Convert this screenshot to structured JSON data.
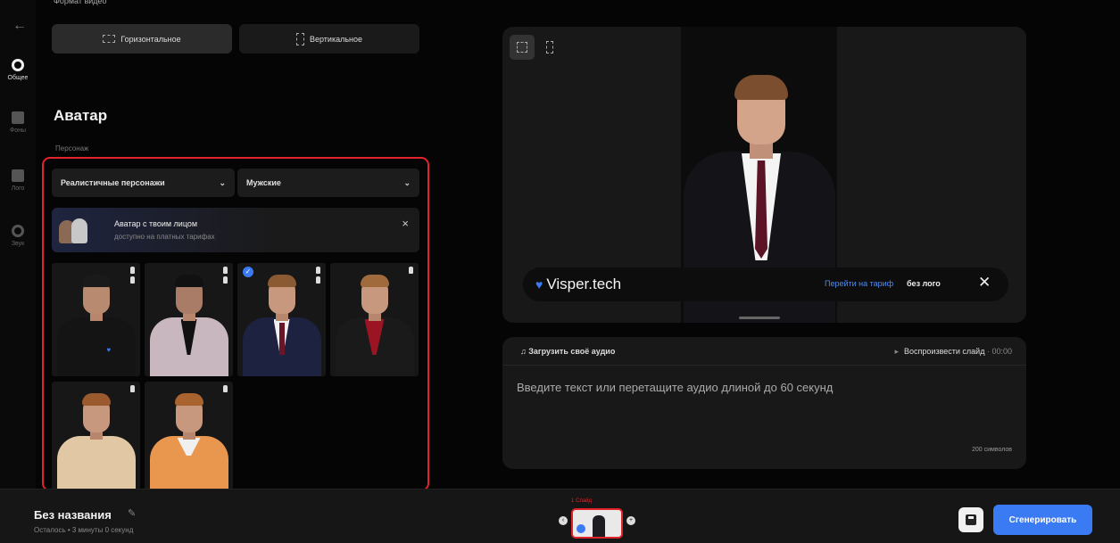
{
  "rail": {
    "items": [
      {
        "label": "Общее",
        "icon": "circle-dot-icon"
      },
      {
        "label": "Фоны",
        "icon": "image-icon"
      },
      {
        "label": "Лого",
        "icon": "layout-icon"
      },
      {
        "label": "Звук",
        "icon": "music-icon"
      }
    ]
  },
  "format": {
    "label": "Формат видео",
    "horizontal": "Горизонтальное",
    "vertical": "Вертикальное"
  },
  "avatar": {
    "title": "Аватар",
    "sub_label": "Персонаж",
    "filter_type": "Реалистичные персонажи",
    "filter_gender": "Мужские",
    "promo_title": "Аватар с твоим лицом",
    "promo_sub": "доступно на платных тарифах",
    "promo_close": "×"
  },
  "preview": {
    "logo_text": "Visper.tech",
    "tariff_link": "Перейти на тариф",
    "tariff_text": "без лого",
    "close": "✕"
  },
  "script": {
    "upload_label": "Загрузить своё аудио",
    "play_label": "Воспроизвести слайд",
    "play_time": "· 00:00",
    "placeholder": "Введите текст или перетащите аудио длиной до 60 секунд",
    "counter": "200 символов"
  },
  "bottom": {
    "title": "Без названия",
    "remaining": "Осталось • 3 минуты 0 секунд",
    "slide_label": "1 Слайд",
    "generate": "Сгенерировать"
  },
  "colors": {
    "accent": "#3a7bf3",
    "highlight": "#e2232b",
    "background": "#050505"
  }
}
